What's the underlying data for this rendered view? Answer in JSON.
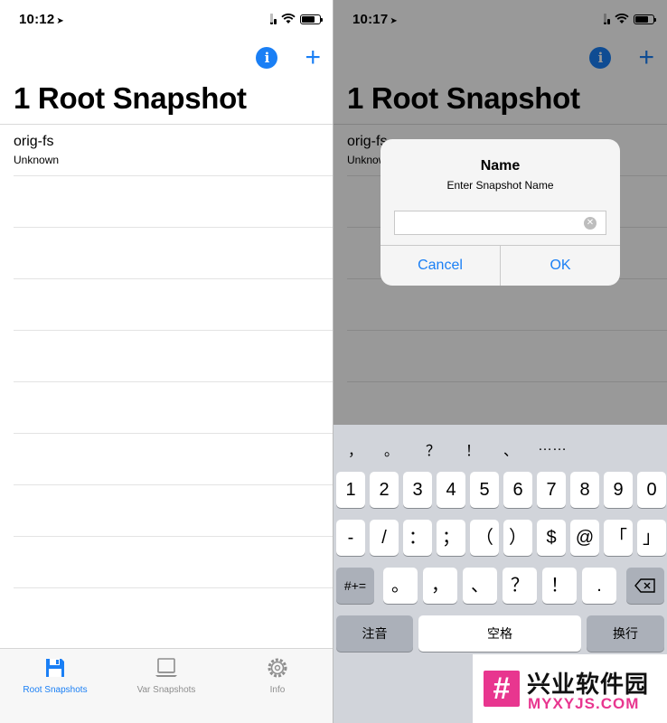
{
  "left": {
    "status": {
      "time": "10:12"
    },
    "title": "1 Root Snapshot",
    "rows": [
      {
        "name": "orig-fs",
        "sub": "Unknown"
      },
      {
        "name": "",
        "sub": ""
      },
      {
        "name": "",
        "sub": ""
      },
      {
        "name": "",
        "sub": ""
      },
      {
        "name": "",
        "sub": ""
      },
      {
        "name": "",
        "sub": ""
      },
      {
        "name": "",
        "sub": ""
      },
      {
        "name": "",
        "sub": ""
      },
      {
        "name": "",
        "sub": ""
      }
    ],
    "tabs": [
      {
        "label": "Root Snapshots",
        "icon": "floppy-disk-icon",
        "active": true
      },
      {
        "label": "Var Snapshots",
        "icon": "laptop-icon",
        "active": false
      },
      {
        "label": "Info",
        "icon": "gear-icon",
        "active": false
      }
    ]
  },
  "right": {
    "status": {
      "time": "10:17"
    },
    "title": "1 Root Snapshot",
    "row": {
      "name": "orig-fs",
      "sub": "Unknown"
    },
    "dialog": {
      "title": "Name",
      "message": "Enter Snapshot Name",
      "input_value": "",
      "cancel": "Cancel",
      "ok": "OK"
    },
    "keyboard": {
      "candidates": [
        "，",
        "。",
        "？",
        "！",
        "、",
        "……"
      ],
      "row1": [
        "1",
        "2",
        "3",
        "4",
        "5",
        "6",
        "7",
        "8",
        "9",
        "0"
      ],
      "row2": [
        "-",
        "/",
        "：",
        "；",
        "（",
        "）",
        "$",
        "@",
        "「",
        "」"
      ],
      "row3_left": "#+=",
      "row3": [
        "。",
        "，",
        "、",
        "？",
        "！",
        "."
      ],
      "row4": {
        "zhuyin": "注音",
        "space": "空格",
        "return": "换行"
      }
    }
  },
  "watermark": {
    "logo": "#",
    "cn": "兴业软件园",
    "en": "MYXYJS.COM"
  },
  "colors": {
    "accent": "#1a7ff5",
    "watermark": "#e8368f"
  }
}
